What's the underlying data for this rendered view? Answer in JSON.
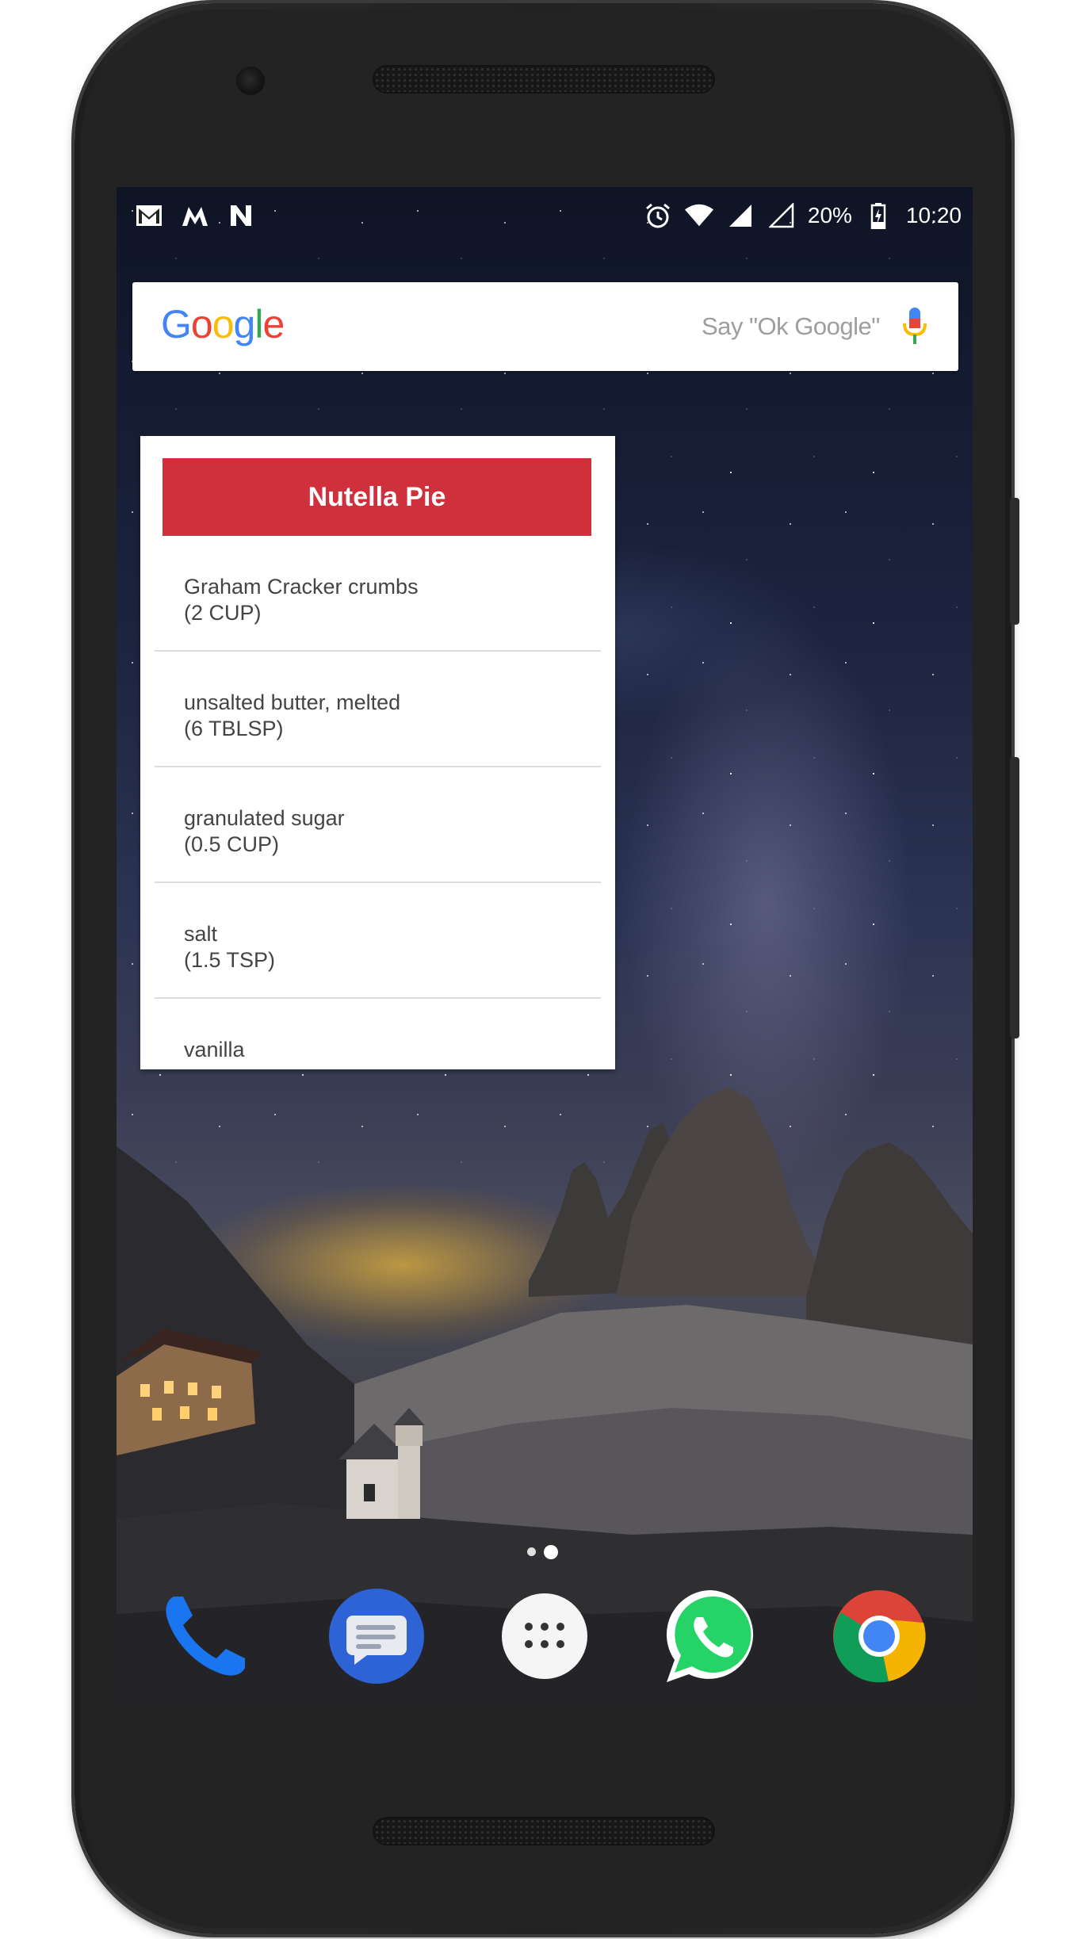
{
  "status_bar": {
    "notification_icons": [
      "gmail-icon",
      "moto-icon",
      "n-notification-icon"
    ],
    "system_icons": [
      "alarm-icon",
      "wifi-icon",
      "signal-icon",
      "no-sim-signal-icon",
      "battery-icon"
    ],
    "battery_percent": "20%",
    "time": "10:20"
  },
  "search_bar": {
    "logo_letters": [
      {
        "char": "G",
        "color": "#4285F4"
      },
      {
        "char": "o",
        "color": "#EA4335"
      },
      {
        "char": "o",
        "color": "#FBBC05"
      },
      {
        "char": "g",
        "color": "#4285F4"
      },
      {
        "char": "l",
        "color": "#34A853"
      },
      {
        "char": "e",
        "color": "#EA4335"
      }
    ],
    "hint": "Say \"Ok Google\"",
    "mic_icon": "mic-icon"
  },
  "recipe_widget": {
    "title": "Nutella Pie",
    "header_color": "#D0303B",
    "ingredients": [
      {
        "name": "Graham Cracker crumbs",
        "quantity": "(2 CUP)"
      },
      {
        "name": "unsalted butter, melted",
        "quantity": "(6 TBLSP)"
      },
      {
        "name": "granulated sugar",
        "quantity": "(0.5 CUP)"
      },
      {
        "name": "salt",
        "quantity": "(1.5 TSP)"
      },
      {
        "name": "vanilla",
        "quantity": ""
      }
    ]
  },
  "home_pages": {
    "count": 2,
    "current": 2
  },
  "dock": {
    "apps": [
      "phone-icon",
      "messages-icon",
      "app-drawer-icon",
      "whatsapp-icon",
      "chrome-icon"
    ]
  }
}
